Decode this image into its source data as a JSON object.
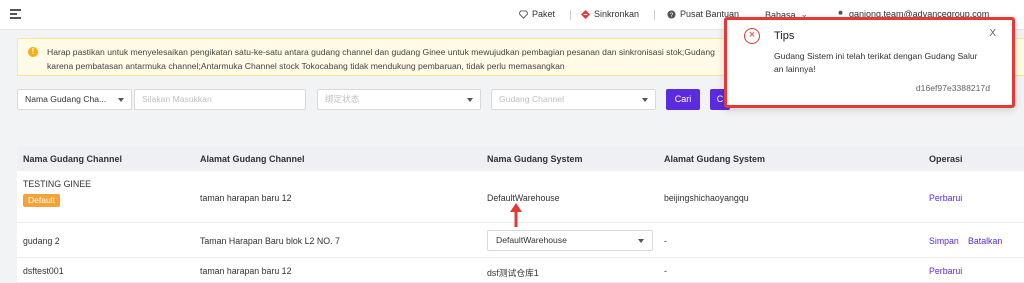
{
  "topbar": {
    "nav": [
      {
        "label": "Paket",
        "icon": "diamond-icon"
      },
      {
        "label": "Sinkronkan",
        "icon": "sync-icon"
      },
      {
        "label": "Pusat Bantuan",
        "icon": "help-icon"
      },
      {
        "label": "Bahasa",
        "icon": "chevron-down-icon"
      },
      {
        "label": "ganjong.team@advancegroup.com",
        "icon": "user-icon"
      }
    ]
  },
  "banner": {
    "line1": "Harap pastikan untuk menyelesaikan pengikatan satu-ke-satu antara gudang channel dan gudang Ginee untuk mewujudkan pembagian pesanan dan sinkronisasi stok;Gudang",
    "line2": "karena pembatasan antarmuka channel;Antarmuka Channel stock Tokocabang tidak mendukung pembaruan, tidak perlu memasangkan"
  },
  "filters": {
    "field_select": "Nama Gudang Cha...",
    "search_placeholder": "Silakan Masukkan",
    "status_placeholder": "绑定状态",
    "channel_placeholder": "Gudang Channel",
    "search_button": "Cari",
    "second_button": "C"
  },
  "table": {
    "headers": [
      "Nama Gudang Channel",
      "Alamat Gudang Channel",
      "Nama Gudang System",
      "Alamat Gudang System",
      "Operasi"
    ],
    "rows": [
      {
        "channel_name": "TESTING GINEE",
        "badge": "Default",
        "channel_address": "taman harapan baru 12",
        "system_name": "DefaultWarehouse",
        "system_address": "beijingshichaoyangqu",
        "op1": "Perbarui"
      },
      {
        "channel_name": "gudang 2",
        "channel_address": "Taman Harapan Baru blok L2 NO. 7",
        "system_select": "DefaultWarehouse",
        "system_address": "-",
        "op1": "Simpan",
        "op2": "Batalkan"
      },
      {
        "channel_name": "dsftest001",
        "channel_address": "taman harapan baru 12",
        "system_name": "dsf测试仓库1",
        "system_address": "-",
        "op1": "Perbarui"
      }
    ]
  },
  "tips": {
    "title": "Tips",
    "message_line1": "Gudang Sistem ini telah terikat dengan Gudang Salur",
    "message_line2": "an lainnya!",
    "code": "d16ef97e3388217d",
    "close": "X"
  },
  "colors": {
    "accent": "#5b2be0",
    "badge": "#f2a43a",
    "error": "#e53935",
    "banner_bg": "#fffbe6"
  }
}
